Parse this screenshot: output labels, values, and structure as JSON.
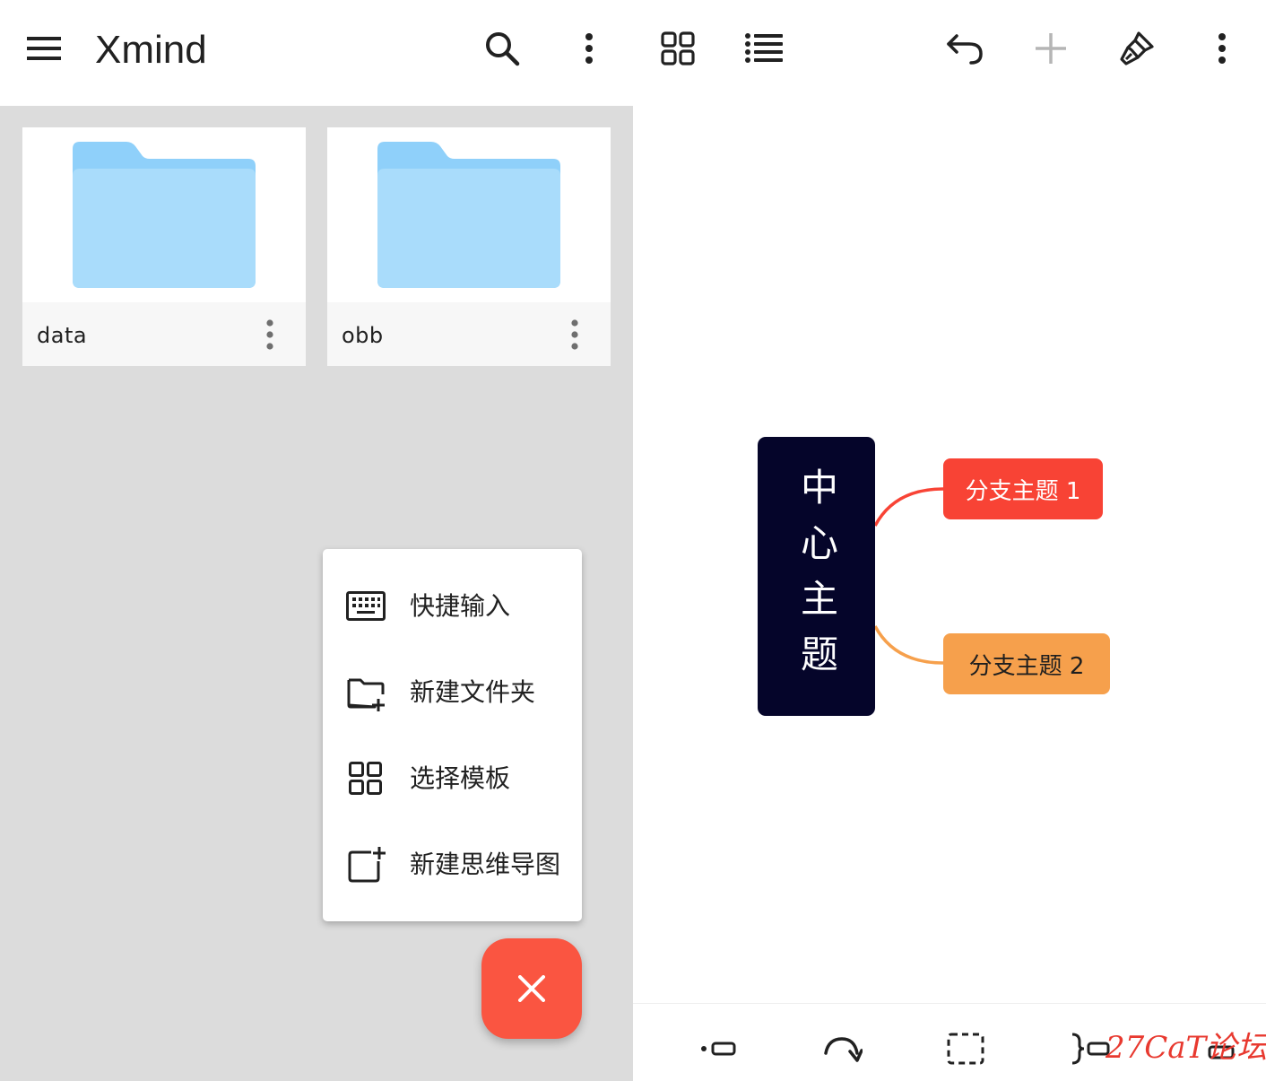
{
  "left": {
    "app_title": "Xmind",
    "folders": [
      {
        "name": "data"
      },
      {
        "name": "obb"
      }
    ],
    "menu": [
      {
        "label": "快捷输入",
        "icon": "keyboard-icon"
      },
      {
        "label": "新建文件夹",
        "icon": "create-new-folder-icon"
      },
      {
        "label": "选择模板",
        "icon": "template-grid-icon"
      },
      {
        "label": "新建思维导图",
        "icon": "new-mindmap-icon"
      }
    ],
    "fab": {
      "icon": "close-icon",
      "color": "#fa5541"
    }
  },
  "right": {
    "toolbar": [
      "grid-view-icon",
      "outline-list-icon",
      "undo-icon",
      "add-icon",
      "style-brush-icon",
      "more-vert-icon"
    ],
    "mindmap": {
      "central_topic": "中心主题",
      "branches": [
        {
          "label": "分支主题 1",
          "color": "#f84335"
        },
        {
          "label": "分支主题 2",
          "color": "#f6a04c"
        }
      ],
      "central_color": "#05052a"
    },
    "bottom_tools": [
      "relationship-icon",
      "redo-arc-icon",
      "boundary-icon",
      "summary-icon"
    ],
    "watermark": "27CaT论坛"
  },
  "colors": {
    "left_background": "#dcdcdc",
    "folder_blue": "#9fd8fb"
  }
}
